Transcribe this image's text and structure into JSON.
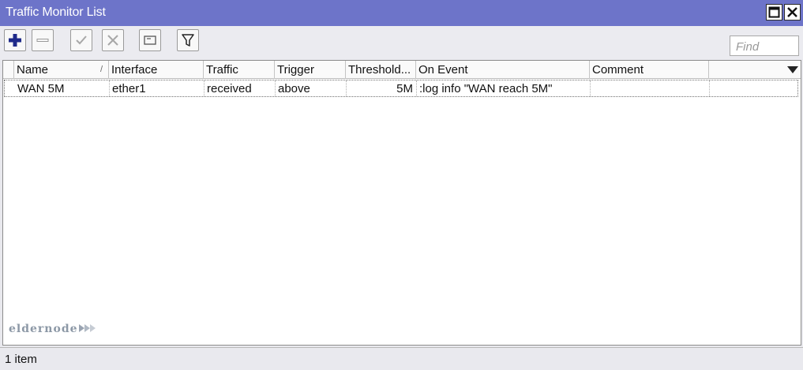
{
  "window": {
    "title": "Traffic Monitor List"
  },
  "toolbar": {
    "buttons": [
      "plus-icon",
      "minus-icon",
      "check-icon",
      "x-icon",
      "comment-icon",
      "filter-icon"
    ],
    "find_placeholder": "Find"
  },
  "table": {
    "columns": [
      "Name",
      "Interface",
      "Traffic",
      "Trigger",
      "Threshold...",
      "On Event",
      "Comment"
    ],
    "sort_column": "Name",
    "rows": [
      {
        "name": "WAN 5M",
        "interface": "ether1",
        "traffic": "received",
        "trigger": "above",
        "threshold": "5M",
        "on_event": ":log info \"WAN reach 5M\"",
        "comment": ""
      }
    ]
  },
  "watermark": {
    "text": "eldernode"
  },
  "status": {
    "text": "1 item"
  },
  "colors": {
    "titlebar": "#6d74c9",
    "add_icon": "#1f2a8a",
    "background": "#e9e9ee"
  }
}
